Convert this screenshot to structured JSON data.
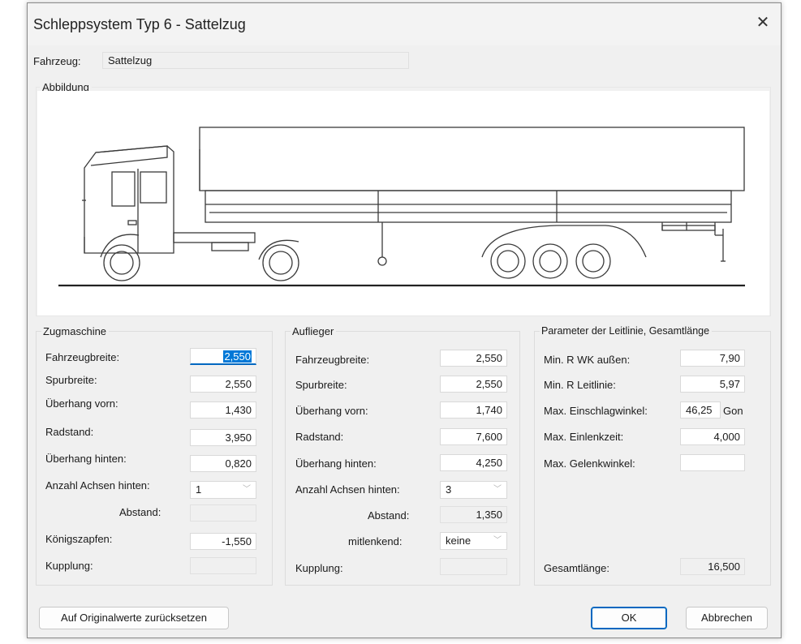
{
  "window": {
    "title": "Schleppsystem Typ 6  -  Sattelzug",
    "close_icon": "close-icon"
  },
  "vehicle": {
    "label": "Fahrzeug:",
    "value": "Sattelzug"
  },
  "picture": {
    "label": "Abbildung"
  },
  "zugmaschine": {
    "title": "Zugmaschine",
    "fahrzeugbreite_label": "Fahrzeugbreite:",
    "fahrzeugbreite": "2,550",
    "spurbreite_label": "Spurbreite:",
    "spurbreite": "2,550",
    "ueberhang_vorn_label": "Überhang vorn:",
    "ueberhang_vorn": "1,430",
    "radstand_label": "Radstand:",
    "radstand": "3,950",
    "ueberhang_hinten_label": "Überhang hinten:",
    "ueberhang_hinten": "0,820",
    "achsen_label": "Anzahl Achsen hinten:",
    "achsen": "1",
    "abstand_label": "Abstand:",
    "abstand": "",
    "koenigszapfen_label": "Königszapfen:",
    "koenigszapfen": "-1,550",
    "kupplung_label": "Kupplung:",
    "kupplung": ""
  },
  "auflieger": {
    "title": "Auflieger",
    "fahrzeugbreite_label": "Fahrzeugbreite:",
    "fahrzeugbreite": "2,550",
    "spurbreite_label": "Spurbreite:",
    "spurbreite": "2,550",
    "ueberhang_vorn_label": "Überhang vorn:",
    "ueberhang_vorn": "1,740",
    "radstand_label": "Radstand:",
    "radstand": "7,600",
    "ueberhang_hinten_label": "Überhang hinten:",
    "ueberhang_hinten": "4,250",
    "achsen_label": "Anzahl Achsen hinten:",
    "achsen": "3",
    "abstand_label": "Abstand:",
    "abstand": "1,350",
    "mitlenkend_label": "mitlenkend:",
    "mitlenkend": "keine",
    "kupplung_label": "Kupplung:",
    "kupplung": ""
  },
  "leitlinie": {
    "title": "Parameter der Leitlinie, Gesamtlänge",
    "min_r_wk_label": "Min. R WK außen:",
    "min_r_wk": "7,90",
    "min_r_leit_label": "Min. R Leitlinie:",
    "min_r_leit": "5,97",
    "einschlag_label": "Max. Einschlagwinkel:",
    "einschlag": "46,25",
    "einschlag_unit": "Gon",
    "einlenkzeit_label": "Max. Einlenkzeit:",
    "einlenkzeit": "4,000",
    "gelenkwinkel_label": "Max. Gelenkwinkel:",
    "gelenkwinkel": "",
    "gesamtlaenge_label": "Gesamtlänge:",
    "gesamtlaenge": "16,500"
  },
  "buttons": {
    "reset": "Auf Originalwerte zurücksetzen",
    "ok": "OK",
    "cancel": "Abbrechen"
  }
}
